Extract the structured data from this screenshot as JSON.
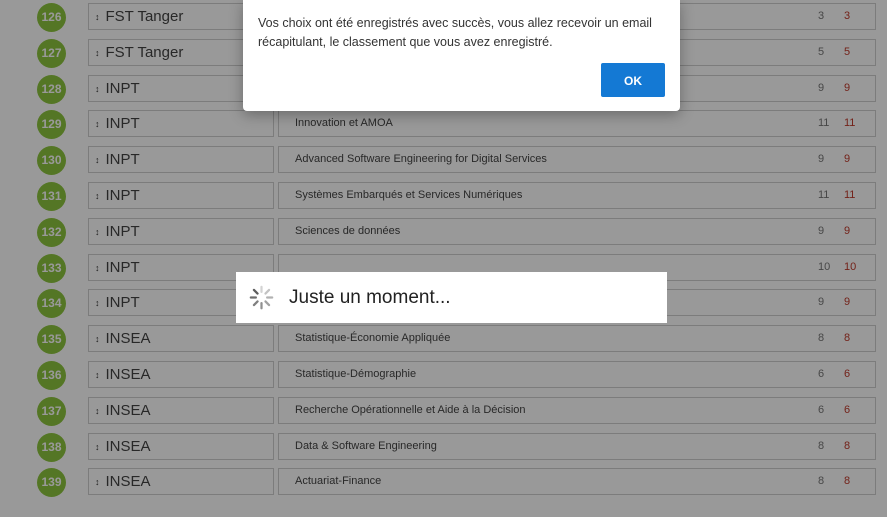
{
  "rows": [
    {
      "num": "126",
      "inst": "FST Tanger",
      "prog": "",
      "c1": "3",
      "c2": "3"
    },
    {
      "num": "127",
      "inst": "FST Tanger",
      "prog": "",
      "c1": "5",
      "c2": "5"
    },
    {
      "num": "128",
      "inst": "INPT",
      "prog": "",
      "c1": "9",
      "c2": "9"
    },
    {
      "num": "129",
      "inst": "INPT",
      "prog": "Innovation et AMOA",
      "c1": "11",
      "c2": "11"
    },
    {
      "num": "130",
      "inst": "INPT",
      "prog": "Advanced Software Engineering for Digital Services",
      "c1": "9",
      "c2": "9"
    },
    {
      "num": "131",
      "inst": "INPT",
      "prog": "Systèmes Embarqués et Services Numériques",
      "c1": "11",
      "c2": "11"
    },
    {
      "num": "132",
      "inst": "INPT",
      "prog": "Sciences de données",
      "c1": "9",
      "c2": "9"
    },
    {
      "num": "133",
      "inst": "INPT",
      "prog": "",
      "c1": "10",
      "c2": "10"
    },
    {
      "num": "134",
      "inst": "INPT",
      "prog": "",
      "c1": "9",
      "c2": "9"
    },
    {
      "num": "135",
      "inst": "INSEA",
      "prog": "Statistique-Économie Appliquée",
      "c1": "8",
      "c2": "8"
    },
    {
      "num": "136",
      "inst": "INSEA",
      "prog": "Statistique-Démographie",
      "c1": "6",
      "c2": "6"
    },
    {
      "num": "137",
      "inst": "INSEA",
      "prog": "Recherche Opérationnelle et Aide à la Décision",
      "c1": "6",
      "c2": "6"
    },
    {
      "num": "138",
      "inst": "INSEA",
      "prog": "Data & Software Engineering",
      "c1": "8",
      "c2": "8"
    },
    {
      "num": "139",
      "inst": "INSEA",
      "prog": "Actuariat-Finance",
      "c1": "8",
      "c2": "8"
    }
  ],
  "alert": {
    "message": "Vos choix ont été enregistrés avec succès, vous allez recevoir un email récapitulant, le classement que vous avez enregistré.",
    "ok_label": "OK"
  },
  "loading": {
    "text": "Juste un moment..."
  },
  "colors": {
    "badge": "#8dc53e",
    "accent_red": "#c0392b",
    "ok_button": "#1479d4"
  }
}
